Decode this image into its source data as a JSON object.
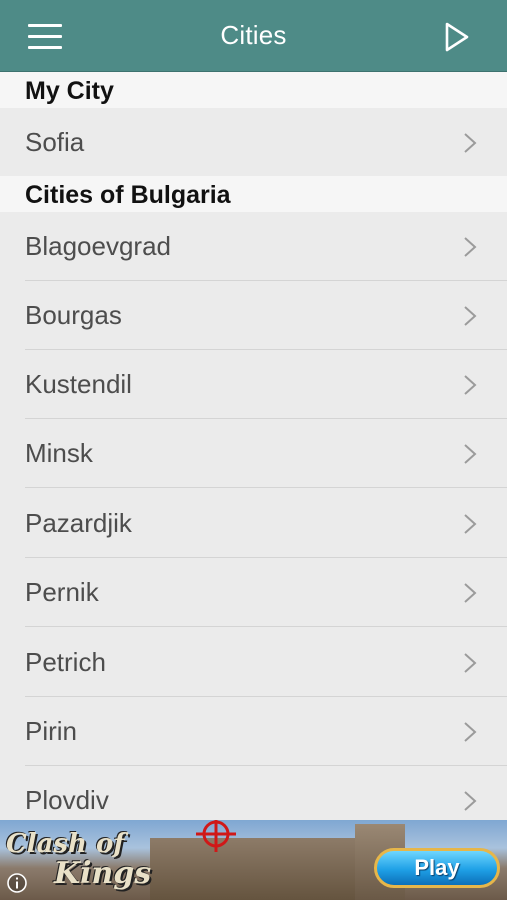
{
  "header": {
    "title": "Cities",
    "menu_icon": "hamburger-menu-icon",
    "action_icon": "play-triangle-icon"
  },
  "sections": [
    {
      "title": "My City",
      "items": [
        "Sofia"
      ]
    },
    {
      "title": "Cities of Bulgaria",
      "items": [
        "Blagoevgrad",
        "Bourgas",
        "Kustendil",
        "Minsk",
        "Pazardjik",
        "Pernik",
        "Petrich",
        "Pirin",
        "Plovdiv"
      ]
    }
  ],
  "ad": {
    "brand_line1": "Clash of",
    "brand_line2": "Kings",
    "play_label": "Play",
    "info_icon": "info-icon"
  },
  "colors": {
    "nav_background": "#4e8b87",
    "row_background": "#ebebeb",
    "header_background": "#f6f6f6"
  }
}
